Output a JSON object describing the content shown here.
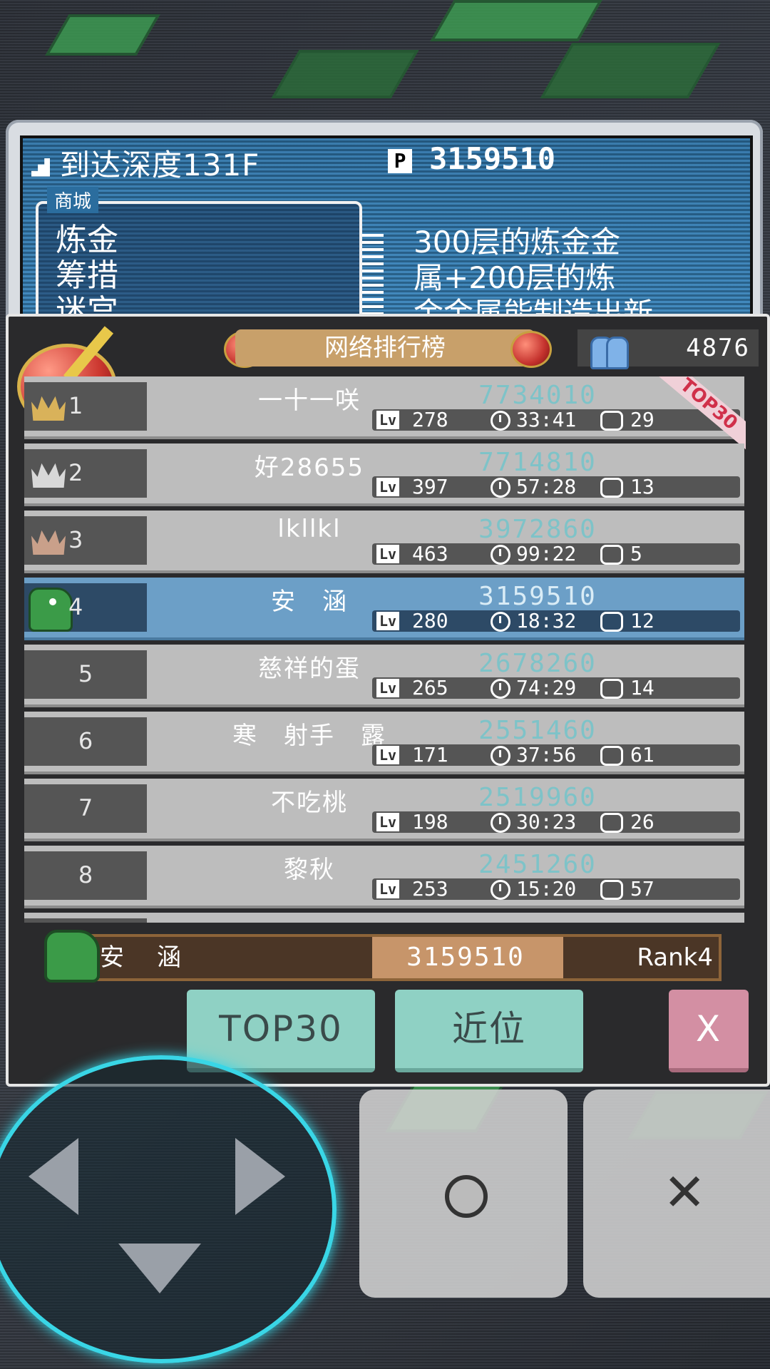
{
  "status_bar": {
    "depth_label": "到达深度131F",
    "points_icon": "P",
    "points_value": "3159510"
  },
  "menu": {
    "title": "商城",
    "items": [
      "炼金",
      "筹措",
      "迷宫"
    ]
  },
  "description": [
    "300层的炼金金",
    "属+200层的炼",
    "金金属能制造出新"
  ],
  "leaderboard": {
    "title": "网络排行榜",
    "online_count": "4876",
    "ribbon": "TOP30",
    "rows": [
      {
        "rank": "1",
        "icon": "gold-crown-icon",
        "name": "一十一咲",
        "score": "7734010",
        "lv_tag": "Lv",
        "level": "278",
        "time": "33:41",
        "loops": "29",
        "crown_color": "#d9b25a"
      },
      {
        "rank": "2",
        "icon": "silver-crown-icon",
        "name": "好28655",
        "score": "7714810",
        "lv_tag": "Lv",
        "level": "397",
        "time": "57:28",
        "loops": "13",
        "crown_color": "#d8d8d8"
      },
      {
        "rank": "3",
        "icon": "bronze-crown-icon",
        "name": "lkllkl",
        "score": "3972860",
        "lv_tag": "Lv",
        "level": "463",
        "time": "99:22",
        "loops": "5",
        "crown_color": "#c9a08a"
      },
      {
        "rank": "4",
        "icon": "dino-avatar-icon",
        "name": "安　涵",
        "score": "3159510",
        "lv_tag": "Lv",
        "level": "280",
        "time": "18:32",
        "loops": "12"
      },
      {
        "rank": "5",
        "name": "慈祥的蛋",
        "score": "2678260",
        "lv_tag": "Lv",
        "level": "265",
        "time": "74:29",
        "loops": "14"
      },
      {
        "rank": "6",
        "name": "寒　射手　露",
        "score": "2551460",
        "lv_tag": "Lv",
        "level": "171",
        "time": "37:56",
        "loops": "61"
      },
      {
        "rank": "7",
        "name": "不吃桃",
        "score": "2519960",
        "lv_tag": "Lv",
        "level": "198",
        "time": "30:23",
        "loops": "26"
      },
      {
        "rank": "8",
        "name": "黎秋",
        "score": "2451260",
        "lv_tag": "Lv",
        "level": "253",
        "time": "15:20",
        "loops": "57"
      }
    ]
  },
  "my_rank": {
    "name": "安　涵",
    "score": "3159510",
    "rank": "Rank4"
  },
  "buttons": {
    "top30": "TOP30",
    "nearby": "近位",
    "close": "X"
  },
  "colors": {
    "highlight_row": "#6c9fc7",
    "header_gold": "#c8a06a",
    "button_teal": "#8fd1c4",
    "button_pink": "#d38fa3",
    "dpad_glow": "#39d6e6"
  }
}
